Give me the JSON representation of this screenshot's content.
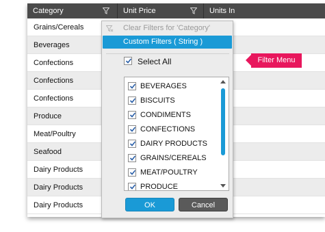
{
  "grid": {
    "columns": [
      {
        "label": "Category"
      },
      {
        "label": "Unit Price"
      },
      {
        "label": "Units In"
      }
    ],
    "rows": [
      {
        "category": "Grains/Cereals",
        "alt": false
      },
      {
        "category": "Beverages",
        "alt": true
      },
      {
        "category": "Confections",
        "alt": false
      },
      {
        "category": "Confections",
        "alt": true
      },
      {
        "category": "Confections",
        "alt": false
      },
      {
        "category": "Produce",
        "alt": true
      },
      {
        "category": "Meat/Poultry",
        "alt": false
      },
      {
        "category": "Seafood",
        "alt": true
      },
      {
        "category": "Dairy Products",
        "alt": false
      },
      {
        "category": "Dairy Products",
        "alt": true
      },
      {
        "category": "Dairy Products",
        "alt": false
      }
    ]
  },
  "filter_menu": {
    "clear_label": "Clear Filters for 'Category'",
    "custom_label": "Custom Filters ( String )",
    "select_all_label": "Select All",
    "select_all_checked": true,
    "items": [
      {
        "label": "BEVERAGES",
        "checked": true
      },
      {
        "label": "BISCUITS",
        "checked": true
      },
      {
        "label": "CONDIMENTS",
        "checked": true
      },
      {
        "label": "CONFECTIONS",
        "checked": true
      },
      {
        "label": "DAIRY PRODUCTS",
        "checked": true
      },
      {
        "label": "GRAINS/CEREALS",
        "checked": true
      },
      {
        "label": "MEAT/POULTRY",
        "checked": true
      },
      {
        "label": "PRODUCE",
        "checked": true
      }
    ],
    "ok_label": "OK",
    "cancel_label": "Cancel"
  },
  "callout": {
    "label": "Filter Menu"
  },
  "colors": {
    "header_bg": "#4a4a4a",
    "accent": "#1a9ad6",
    "callout": "#e8175d",
    "alt_row": "#ececec"
  }
}
